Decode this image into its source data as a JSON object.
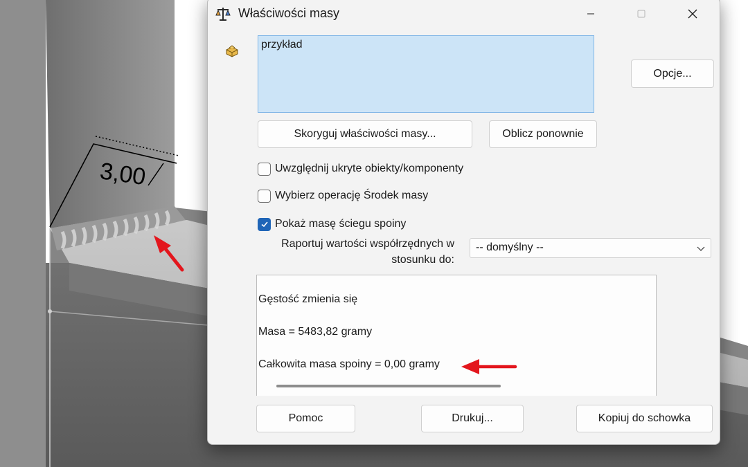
{
  "dialog": {
    "title": "Właściwości masy",
    "icons": {
      "app": "scale-icon",
      "minimize": "minimize-icon",
      "maximize": "maximize-icon",
      "close": "close-icon",
      "part": "part-icon"
    },
    "selected_item": "przykład",
    "options_button": "Opcje...",
    "override_button": "Skoryguj właściwości masy...",
    "recalculate_button": "Oblicz ponownie",
    "checkboxes": [
      {
        "label": "Uwzględnij ukryte obiekty/komponenty",
        "checked": false
      },
      {
        "label": "Wybierz operację Środek masy",
        "checked": false
      },
      {
        "label": "Pokaż masę ściegu spoiny",
        "checked": true
      }
    ],
    "report_label_line1": "Raportuj wartości współrzędnych w",
    "report_label_line2": "stosunku do:",
    "coordinate_system": "-- domyślny --",
    "results": {
      "line1": "Gęstość zmienia się",
      "line2": "Masa = 5483,82 gramy",
      "line3": "Całkowita masa spoiny = 0,00 gramy"
    },
    "help_button": "Pomoc",
    "print_button": "Drukuj...",
    "copy_button": "Kopiuj do schowka"
  },
  "background": {
    "weld_dimension": "3,00"
  },
  "colors": {
    "accent": "#1f65b7",
    "selection": "#cce4f7",
    "arrow": "#e3161d"
  }
}
